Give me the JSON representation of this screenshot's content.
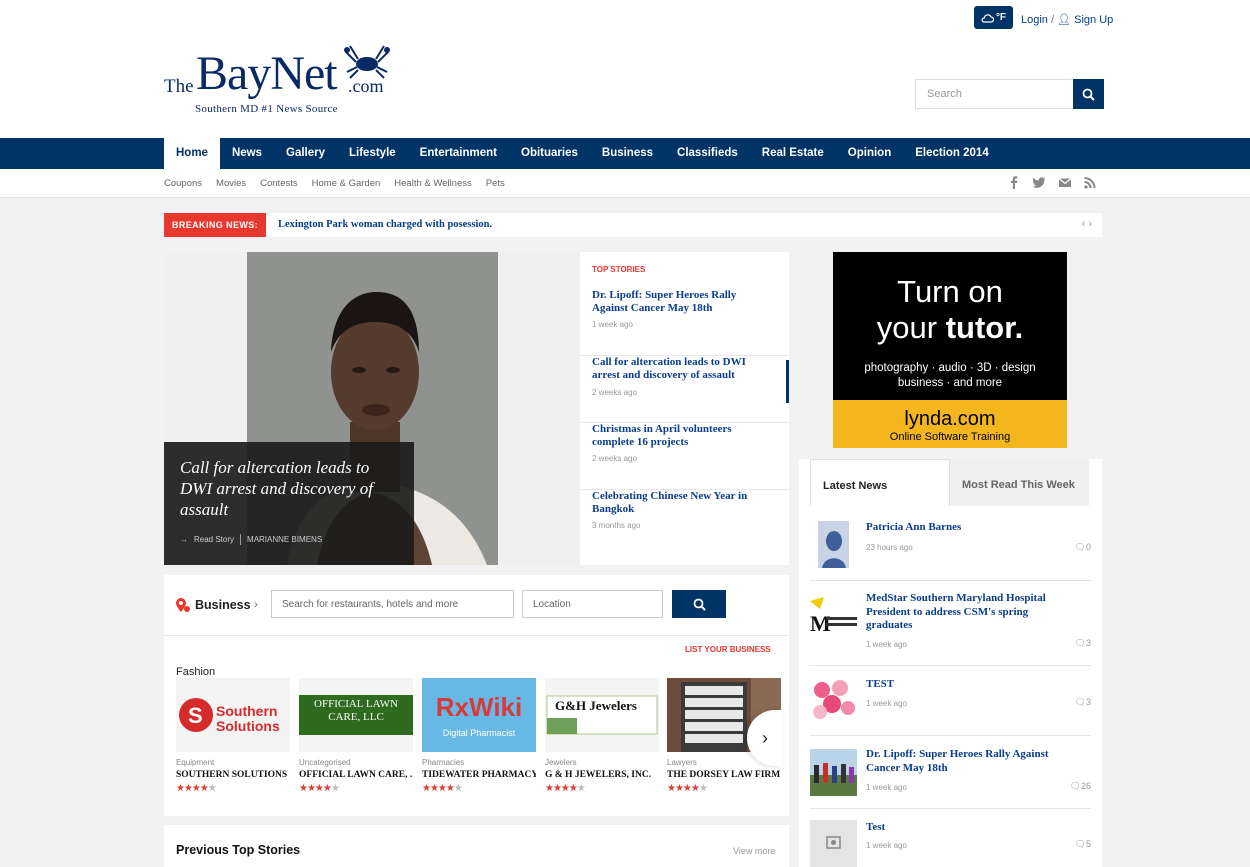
{
  "header": {
    "weather_label": "°F",
    "login": "Login",
    "slash": "/",
    "signup": "Sign Up",
    "logo": {
      "the": "The",
      "name": "BayNet",
      "com": ".com",
      "tagline": "Southern MD #1 News Source"
    },
    "search_placeholder": "Search"
  },
  "nav": {
    "items": [
      "Home",
      "News",
      "Gallery",
      "Lifestyle",
      "Entertainment",
      "Obituaries",
      "Business",
      "Classifieds",
      "Real Estate",
      "Opinion",
      "Election 2014"
    ],
    "active": "Home"
  },
  "subnav": {
    "items": [
      "Coupons",
      "Movies",
      "Contests",
      "Home & Garden",
      "Health & Wellness",
      "Pets"
    ]
  },
  "social": [
    "facebook-icon",
    "twitter-icon",
    "email-icon",
    "rss-icon"
  ],
  "breaking": {
    "label": "BREAKING NEWS:",
    "text": "Lexington Park woman charged with posession.",
    "arrows": "‹  ›"
  },
  "feature": {
    "title": "Call for altercation leads to DWI arrest and discovery of assault",
    "read_story": "Read Story",
    "author": "MARIANNE BIMENS"
  },
  "top_stories": {
    "heading": "TOP STORIES",
    "items": [
      {
        "title": "Dr. Lipoff: Super Heroes Rally Against Cancer May 18th",
        "date": "1 week ago"
      },
      {
        "title": "Call for altercation leads to DWI arrest and discovery of assault",
        "date": "2 weeks ago"
      },
      {
        "title": "Christmas in April volunteers complete 16 projects",
        "date": "2 weeks ago"
      },
      {
        "title": "Celebrating Chinese New Year in Bangkok",
        "date": "3 months ago"
      }
    ]
  },
  "ad": {
    "line1": "Turn on",
    "line2a": "your ",
    "line2b": "tutor.",
    "line3": "photography · audio · 3D · design",
    "line4": "business · and more",
    "brand": "lynda.com",
    "brand_sub": "Online Software Training"
  },
  "latest": {
    "tab_latest": "Latest News",
    "tab_most_read": "Most Read This Week",
    "items": [
      {
        "title": "Patricia Ann Barnes",
        "date": "23 hours ago",
        "comments": "0"
      },
      {
        "title": "MedStar Southern Maryland Hospital President to address CSM's spring graduates",
        "date": "1 week ago",
        "comments": "3"
      },
      {
        "title": "TEST",
        "date": "1 week ago",
        "comments": "3"
      },
      {
        "title": "Dr. Lipoff: Super Heroes Rally Against Cancer May 18th",
        "date": "1 week ago",
        "comments": "26"
      },
      {
        "title": "Test",
        "date": "1 week ago",
        "comments": "5"
      }
    ]
  },
  "business": {
    "label": "Business",
    "search_placeholder": "Search for restaurants, hotels and more",
    "location_placeholder": "Location",
    "list_your_business": "LIST YOUR BUSINESS",
    "section": "Fashion",
    "cards": [
      {
        "category": "Equipment",
        "name": "SOUTHERN SOLUTIONS",
        "rating": 3.5,
        "logo_text": "Southern Solutions"
      },
      {
        "category": "Uncategorised",
        "name": "OFFICIAL LAWN CARE, ...",
        "rating": 3.5,
        "logo_text": "OFFICIAL LAWN CARE, LLC"
      },
      {
        "category": "Pharmacies",
        "name": "TIDEWATER PHARMACY",
        "rating": 3.5,
        "logo_text": "RxWiki"
      },
      {
        "category": "Jewelers",
        "name": "G & H JEWELERS, INC.",
        "rating": 3.5,
        "logo_text": "G&H Jewelers"
      },
      {
        "category": "Lawyers",
        "name": "THE DORSEY LAW FIRM",
        "rating": 3.5,
        "logo_text": ""
      }
    ]
  },
  "previous": {
    "title": "Previous Top Stories",
    "view_more": "View more"
  },
  "colors": {
    "brand_navy": "#003366",
    "link_blue": "#0a3d8f",
    "breaking_red": "#e8372f",
    "star_red": "#d9403a",
    "ad_yellow": "#f3b71d"
  }
}
